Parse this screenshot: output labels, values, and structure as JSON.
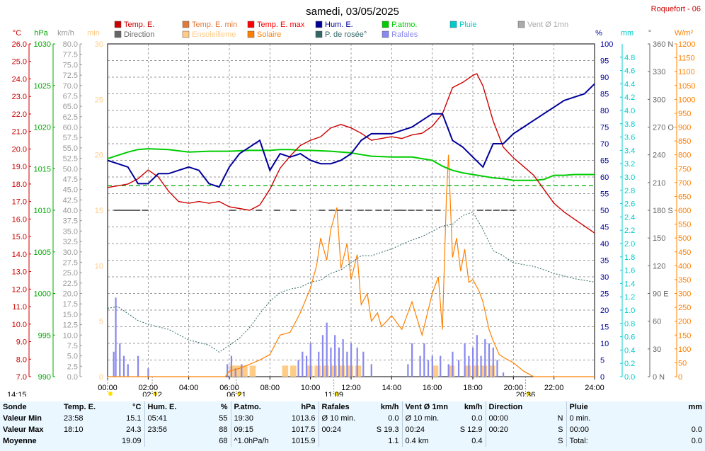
{
  "station": "Roquefort - 06",
  "colors": {
    "temp": "#cc0000",
    "temp_min": "#e07a3a",
    "temp_max": "#ff0000",
    "hum": "#000099",
    "press": "#00cc00",
    "rain": "#00cccc",
    "wind": "#aaaaaa",
    "dir": "#666666",
    "sun": "#ffcc88",
    "solar": "#ff8000",
    "dew": "#336666",
    "gust": "#8888ee"
  },
  "chart_data": {
    "type": "line",
    "title": "samedi, 03/05/2025",
    "x_ticks": [
      "00:00",
      "02:00",
      "04:00",
      "06:00",
      "08:00",
      "10:00",
      "12:00",
      "14:00",
      "16:00",
      "18:00",
      "20:00",
      "22:00",
      "24:00"
    ],
    "legend": [
      {
        "label": "Temp. E.",
        "color": "#cc0000"
      },
      {
        "label": "Temp. E. min",
        "color": "#e07a3a"
      },
      {
        "label": "Temp. E. max",
        "color": "#ff0000"
      },
      {
        "label": "Hum. E.",
        "color": "#000099"
      },
      {
        "label": "P.atmo.",
        "color": "#00cc00"
      },
      {
        "label": "Pluie",
        "color": "#00cccc"
      },
      {
        "label": "Vent Ø 1mn",
        "color": "#aaaaaa"
      },
      {
        "label": "Direction",
        "color": "#666666"
      },
      {
        "label": "Ensoleilleme",
        "color": "#ffcc88"
      },
      {
        "label": "Solaire",
        "color": "#ff8000"
      },
      {
        "label": "P. de rosée°",
        "color": "#336666"
      },
      {
        "label": "Rafales",
        "color": "#8888ee"
      }
    ],
    "axes": {
      "temp": {
        "unit": "°C",
        "range": [
          7.0,
          26.0
        ],
        "ticks": [
          "26.0",
          "25.0",
          "24.0",
          "23.0",
          "22.0",
          "21.0",
          "20.0",
          "19.0",
          "18.0",
          "17.0",
          "16.0",
          "15.0",
          "14.0",
          "13.0",
          "12.0",
          "11.0",
          "10.0",
          "9.0",
          "8.0",
          "7.0"
        ]
      },
      "press": {
        "unit": "hPa",
        "range": [
          990,
          1030
        ],
        "ticks": [
          "1030",
          "1025",
          "1020",
          "1015",
          "1010",
          "1005",
          "1000",
          "995",
          "990"
        ]
      },
      "wind": {
        "unit": "km/h",
        "range": [
          0,
          80
        ],
        "ticks": [
          "80.0",
          "77.5",
          "75.0",
          "72.5",
          "70.0",
          "67.5",
          "65.0",
          "62.5",
          "60.0",
          "57.5",
          "55.0",
          "52.5",
          "50.0",
          "47.5",
          "45.0",
          "42.5",
          "40.0",
          "37.5",
          "35.0",
          "32.5",
          "30.0",
          "27.5",
          "25.0",
          "22.5",
          "20.0",
          "17.5",
          "15.0",
          "12.5",
          "10.0",
          "7.5",
          "5.0",
          "2.5",
          "0.0"
        ]
      },
      "sun": {
        "unit": "min",
        "range": [
          0,
          30
        ],
        "ticks": [
          "30",
          "25",
          "20",
          "15",
          "10",
          "5",
          "0"
        ]
      },
      "hum": {
        "unit": "%",
        "range": [
          0,
          100
        ],
        "ticks": [
          "100",
          "95",
          "90",
          "85",
          "80",
          "75",
          "70",
          "65",
          "60",
          "55",
          "50",
          "45",
          "40",
          "35",
          "30",
          "25",
          "20",
          "15",
          "10",
          "5",
          "0"
        ]
      },
      "rain": {
        "unit": "mm",
        "range": [
          0,
          5
        ],
        "ticks": [
          "4.8",
          "4.6",
          "4.4",
          "4.2",
          "4.0",
          "3.8",
          "3.6",
          "3.4",
          "3.2",
          "3.0",
          "2.8",
          "2.6",
          "2.4",
          "2.2",
          "2.0",
          "1.8",
          "1.6",
          "1.4",
          "1.2",
          "1.0",
          "0.8",
          "0.6",
          "0.4",
          "0.2",
          "0.0"
        ]
      },
      "dir": {
        "unit": "°",
        "range": [
          0,
          360
        ],
        "ticks": [
          "360 N",
          "330",
          "300",
          "270 O",
          "240",
          "210",
          "180 S",
          "150",
          "120",
          "90 E",
          "60",
          "30",
          "0 N"
        ]
      },
      "solar": {
        "unit": "W/m²",
        "range": [
          0,
          1200
        ],
        "ticks": [
          "1200",
          "1150",
          "1100",
          "1050",
          "1000",
          "950",
          "900",
          "850",
          "800",
          "750",
          "700",
          "650",
          "600",
          "550",
          "500",
          "450",
          "400",
          "350",
          "300",
          "250",
          "200",
          "150",
          "100",
          "50",
          "0"
        ]
      }
    },
    "series": [
      {
        "name": "Temp. E.",
        "axis": "temp",
        "x": [
          0,
          0.5,
          1,
          1.5,
          2,
          2.5,
          3,
          3.5,
          4,
          4.5,
          5,
          5.5,
          6,
          6.5,
          7,
          7.5,
          8,
          8.5,
          9,
          9.5,
          10,
          10.5,
          11,
          11.5,
          12,
          12.5,
          13,
          13.5,
          14,
          14.5,
          15,
          15.5,
          16,
          16.5,
          17,
          17.5,
          18,
          18.2,
          18.5,
          19,
          19.5,
          20,
          20.5,
          21,
          21.5,
          22,
          22.5,
          23,
          23.5,
          24
        ],
        "y": [
          17.8,
          17.9,
          18.0,
          18.3,
          18.8,
          18.4,
          17.6,
          17.0,
          16.9,
          17.0,
          16.9,
          17.0,
          16.7,
          16.6,
          16.5,
          16.8,
          17.7,
          18.9,
          19.6,
          20.2,
          20.5,
          20.7,
          21.2,
          21.4,
          21.2,
          20.9,
          20.5,
          20.6,
          20.7,
          20.6,
          20.8,
          20.9,
          21.3,
          22.0,
          23.5,
          23.8,
          24.2,
          24.3,
          23.6,
          21.6,
          20.1,
          19.5,
          19.0,
          18.5,
          17.7,
          16.9,
          16.4,
          16.0,
          15.6,
          15.2
        ]
      },
      {
        "name": "Hum. E.",
        "axis": "hum",
        "x": [
          0,
          0.5,
          1,
          1.5,
          2,
          2.5,
          3,
          3.5,
          4,
          4.5,
          5,
          5.5,
          6,
          6.5,
          7,
          7.5,
          8,
          8.5,
          9,
          9.5,
          10,
          10.5,
          11,
          11.5,
          12,
          12.5,
          13,
          13.5,
          14,
          14.5,
          15,
          15.5,
          16,
          16.5,
          17,
          17.5,
          18,
          18.5,
          19,
          19.5,
          20,
          20.5,
          21,
          21.5,
          22,
          22.5,
          23,
          23.5,
          24
        ],
        "y": [
          65,
          64,
          63,
          58,
          58,
          61,
          61,
          62,
          63,
          62,
          58,
          57,
          63,
          67,
          69,
          71,
          62,
          67,
          66,
          67,
          65,
          64,
          64,
          65,
          67,
          71,
          73,
          73,
          73,
          74,
          75,
          77,
          79,
          79,
          71,
          69,
          66,
          63,
          70,
          70,
          73,
          75,
          77,
          79,
          81,
          83,
          84,
          85,
          88
        ]
      },
      {
        "name": "P.atmo.",
        "axis": "press",
        "x": [
          0,
          0.5,
          1,
          1.5,
          2,
          3,
          4,
          5,
          6,
          7,
          8,
          8.5,
          9,
          9.5,
          10,
          11,
          12,
          12.5,
          13,
          14,
          15,
          16,
          16.5,
          17,
          17.5,
          18,
          18.5,
          19,
          19.5,
          20,
          20.5,
          21,
          21.5,
          22,
          22.5,
          23,
          23.5,
          24
        ],
        "y": [
          1016.2,
          1016.6,
          1017.0,
          1017.3,
          1017.4,
          1017.3,
          1017.0,
          1017.1,
          1017.1,
          1017.2,
          1017.2,
          1017.3,
          1017.3,
          1017.2,
          1017.2,
          1017.1,
          1016.9,
          1016.7,
          1016.5,
          1016.4,
          1016.4,
          1016.0,
          1015.3,
          1014.8,
          1014.5,
          1014.3,
          1014.1,
          1013.9,
          1013.8,
          1013.6,
          1013.6,
          1013.6,
          1013.7,
          1014.2,
          1014.2,
          1014.3,
          1014.3,
          1014.3
        ]
      },
      {
        "name": "P. de rosée°",
        "axis": "temp",
        "x": [
          0,
          0.5,
          1,
          1.5,
          2,
          3,
          4,
          5,
          5.5,
          6,
          6.5,
          7,
          7.5,
          8,
          8.5,
          9,
          9.5,
          10,
          10.5,
          11,
          11.5,
          12,
          12.5,
          13,
          14,
          15,
          15.5,
          16,
          16.5,
          17,
          17.5,
          18,
          18.5,
          19,
          19.5,
          20,
          21,
          22,
          23,
          24
        ],
        "y": [
          10.9,
          11.0,
          10.6,
          10.2,
          10.0,
          9.7,
          9.1,
          8.8,
          8.4,
          8.8,
          9.2,
          9.8,
          10.6,
          11.3,
          11.8,
          12.0,
          12.1,
          12.4,
          12.5,
          12.9,
          13.1,
          13.5,
          13.9,
          13.9,
          14.3,
          14.8,
          15.0,
          15.3,
          15.6,
          15.7,
          16.2,
          16.4,
          15.4,
          14.2,
          13.9,
          13.5,
          13.3,
          12.9,
          12.6,
          12.4
        ]
      },
      {
        "name": "Solaire",
        "axis": "solar",
        "x": [
          0,
          5.8,
          6,
          6.5,
          7,
          7.5,
          8,
          8.5,
          9,
          9.5,
          10,
          10.3,
          10.5,
          10.8,
          11,
          11.3,
          11.5,
          11.8,
          12,
          12.3,
          12.5,
          12.8,
          13,
          13.3,
          13.5,
          14,
          14.5,
          15,
          15.5,
          16,
          16.3,
          16.5,
          16.7,
          16.8,
          17,
          17.2,
          17.4,
          17.6,
          17.8,
          18,
          18.3,
          18.5,
          18.8,
          19,
          19.3,
          19.5,
          20,
          20.5,
          21,
          24
        ],
        "y": [
          0,
          0,
          20,
          30,
          45,
          60,
          80,
          150,
          160,
          230,
          320,
          400,
          500,
          420,
          530,
          610,
          390,
          480,
          350,
          440,
          260,
          300,
          200,
          230,
          180,
          220,
          170,
          270,
          150,
          300,
          360,
          170,
          650,
          800,
          430,
          500,
          380,
          460,
          340,
          350,
          310,
          270,
          170,
          130,
          80,
          70,
          50,
          20,
          0,
          0
        ]
      },
      {
        "name": "Rafales",
        "axis": "wind",
        "x": [
          0,
          0.3,
          0.4,
          0.6,
          0.8,
          1,
          1.5,
          2,
          2.5,
          4,
          5.5,
          5.9,
          6.1,
          6.3,
          6.6,
          7,
          8,
          9,
          9.4,
          9.6,
          9.8,
          10,
          10.4,
          10.6,
          10.8,
          11,
          11.2,
          11.4,
          11.6,
          11.8,
          12,
          12.3,
          12.6,
          13,
          14,
          14.8,
          15,
          15.4,
          15.6,
          15.8,
          16,
          16.4,
          16.8,
          17,
          17.3,
          17.6,
          17.8,
          18,
          18.2,
          18.4,
          18.6,
          18.8,
          19,
          19.2,
          19.5,
          20,
          24
        ],
        "y": [
          0,
          6,
          19,
          8,
          5,
          3,
          5,
          2,
          0,
          0,
          0,
          3,
          5,
          2,
          3,
          0,
          0,
          0,
          4,
          6,
          5,
          8,
          6,
          10,
          13,
          7,
          10,
          7,
          9,
          6,
          8,
          7,
          6,
          3,
          0,
          3,
          8,
          5,
          8,
          4,
          5,
          5,
          3,
          6,
          4,
          8,
          5,
          7,
          10,
          5,
          9,
          8,
          7,
          4,
          1,
          0,
          0
        ]
      },
      {
        "name": "Direction",
        "axis": "dir",
        "x": [
          0.3,
          0.6,
          0.9,
          1.1,
          1.3,
          1.7,
          6.0,
          7.3,
          8.2,
          9.0,
          10.4,
          10.9,
          11.3,
          11.7,
          12.3,
          12.7,
          13.2,
          13.6,
          14.1,
          14.4,
          14.8,
          15.2,
          15.7,
          16.1,
          18.2,
          18.6,
          19.0,
          19.4,
          19.8
        ],
        "y": [
          180,
          180,
          180,
          180,
          180,
          180,
          180,
          180,
          180,
          180,
          180,
          180,
          180,
          180,
          180,
          180,
          180,
          180,
          180,
          180,
          180,
          180,
          180,
          180,
          180,
          180,
          180,
          180,
          180
        ]
      },
      {
        "name": "Ensoleilleme",
        "axis": "sun",
        "x": [
          6.0,
          6.3,
          6.6,
          7.0,
          7.4,
          7.8,
          8.2,
          8.6,
          9.0,
          9.4,
          9.8,
          10.2,
          10.6,
          11.0,
          11.4,
          11.8,
          12.2,
          16.0,
          16.4,
          16.8,
          17.2,
          17.6,
          18.0,
          18.4,
          18.8,
          19.2
        ],
        "y": [
          1,
          1,
          1,
          1,
          0,
          0,
          0,
          1,
          1,
          0,
          1,
          1,
          1,
          1,
          1,
          1,
          1,
          1,
          0,
          1,
          0,
          1,
          1,
          1,
          1,
          0
        ]
      },
      {
        "name": "Temp. E. min",
        "axis": "temp",
        "x": [
          0,
          24
        ],
        "y": [
          17.9,
          17.9
        ]
      }
    ],
    "markers": [
      {
        "time": "14:15",
        "x": 0.0
      },
      {
        "time": "02:12",
        "x": 2.2
      },
      {
        "time": "06:21",
        "x": 6.35
      },
      {
        "time": "11:09",
        "x": 11.15
      },
      {
        "time": "20:36",
        "x": 20.6
      }
    ]
  },
  "stats": {
    "headers": [
      "Sonde",
      "Temp. E.",
      "°C",
      "Hum. E.",
      "%",
      "P.atmo.",
      "hPa",
      "Rafales",
      "km/h",
      "Vent Ø 1mn",
      "km/h",
      "Direction",
      "",
      "Pluie",
      "mm"
    ],
    "rows": [
      [
        "Valeur Min",
        "23:58",
        "15.1",
        "05:41",
        "55",
        "19:30",
        "1013.6",
        "Ø 10 min.",
        "0.0",
        "Ø 10 min.",
        "0.0",
        "00:00",
        "N",
        "0 min.",
        ""
      ],
      [
        "Valeur Max",
        "18:10",
        "24.3",
        "23:56",
        "88",
        "09:15",
        "1017.5",
        "00:24",
        "S 19.3",
        "00:24",
        "S 12.9",
        "00:20",
        "S",
        "00:00",
        "0.0"
      ],
      [
        "Moyenne",
        "",
        "19.09",
        "",
        "68",
        "^1.0hPa/h",
        "1015.9",
        "",
        "1.1",
        "0.4 km",
        "0.4",
        "",
        "S",
        "Total:",
        "0.0"
      ]
    ]
  }
}
